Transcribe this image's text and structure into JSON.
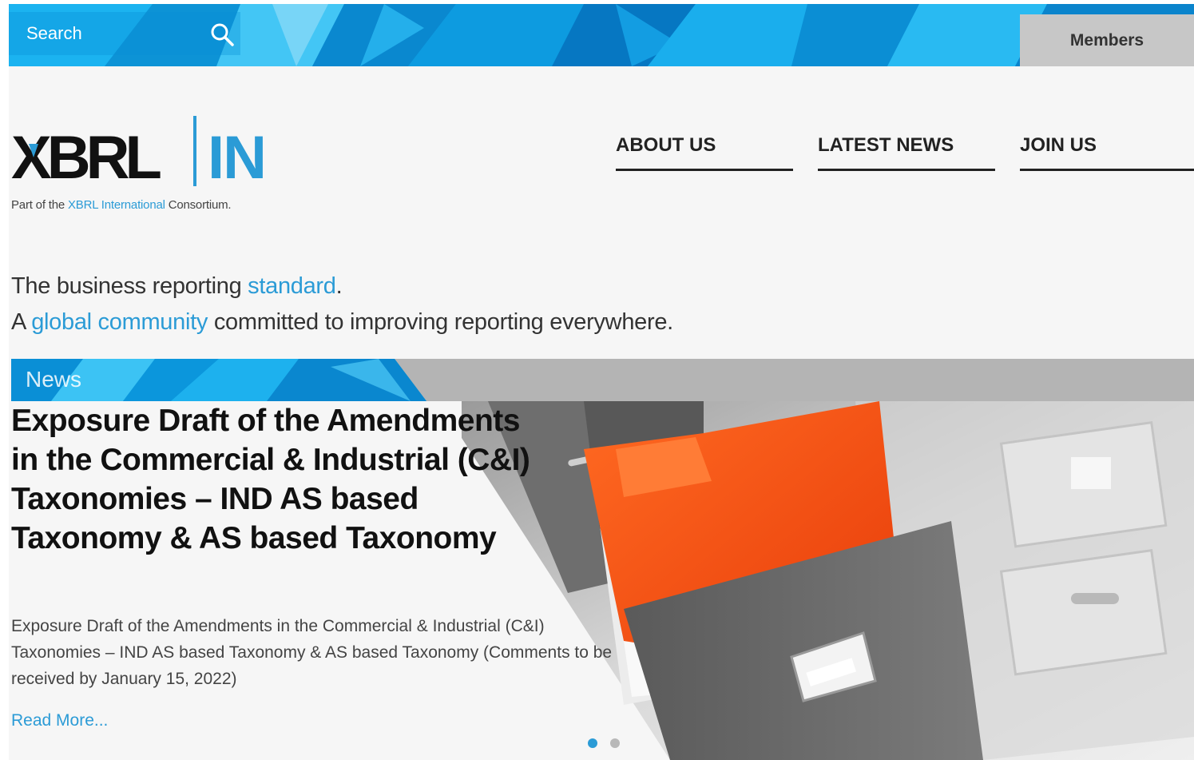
{
  "search": {
    "placeholder": "Search"
  },
  "header": {
    "members_label": "Members"
  },
  "logo": {
    "text_left": "XBRL",
    "text_right": "IN",
    "tagline_prefix": "Part of the ",
    "tagline_link": "XBRL International",
    "tagline_suffix": " Consortium."
  },
  "nav": {
    "items": [
      {
        "label": "ABOUT US"
      },
      {
        "label": "LATEST NEWS"
      },
      {
        "label": "JOIN US"
      }
    ]
  },
  "hero": {
    "line1_prefix": "The business reporting ",
    "line1_link": "standard",
    "line1_suffix": ".",
    "line2_prefix": "A ",
    "line2_link": "global community",
    "line2_suffix": " committed to improving reporting everywhere."
  },
  "news": {
    "section_label": "News",
    "title": "Exposure Draft of the Amendments in the Commercial & Industrial (C&I) Taxonomies – IND AS based Taxonomy & AS based Taxonomy",
    "summary": "Exposure Draft of the Amendments in the Commercial & Industrial (C&I) Taxonomies – IND AS based Taxonomy & AS based Taxonomy (Comments to be received by January 15, 2022)",
    "read_more": "Read More...",
    "slides": {
      "count": 2,
      "active": 1
    }
  },
  "colors": {
    "accent": "#2b9bd6",
    "banner_blue": "#12a9e6",
    "members_bg": "#c7c7c7",
    "page_bg": "#f6f6f6"
  }
}
